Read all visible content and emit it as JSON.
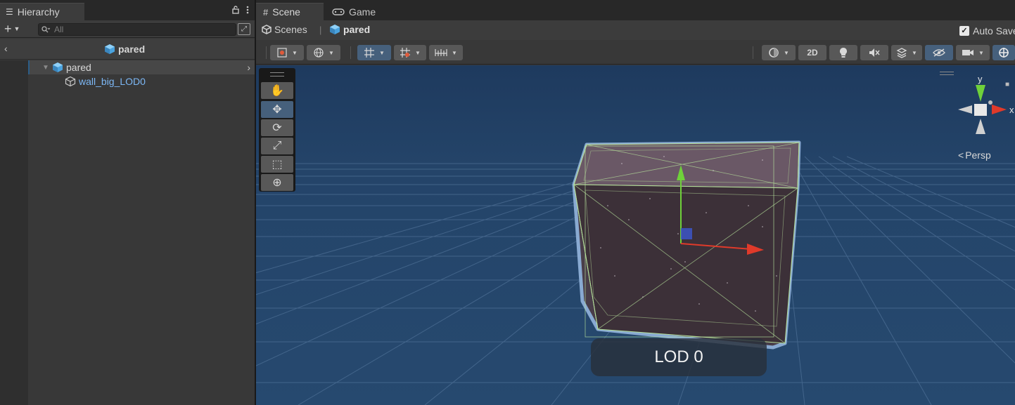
{
  "hierarchy": {
    "tab_label": "Hierarchy",
    "search_placeholder": "All",
    "scene_name": "pared",
    "items": [
      {
        "label": "pared"
      },
      {
        "label": "wall_big_LOD0"
      }
    ]
  },
  "scene_view": {
    "tabs": [
      {
        "label": "Scene"
      },
      {
        "label": "Game"
      }
    ],
    "breadcrumb": {
      "root": "Scenes",
      "current": "pared"
    },
    "auto_save": {
      "label": "Auto Save",
      "checked": true
    },
    "toolbar": {
      "mode_2d": "2D"
    },
    "gizmo": {
      "y_label": "y",
      "x_label": "x",
      "projection": "Persp"
    },
    "lod_label": "LOD 0"
  },
  "colors": {
    "selection_blue": "#46607c",
    "hierarchy_child_text": "#7cb7f5",
    "viewport_sky": "#1f3a5c",
    "gizmo_y": "#6fd13a",
    "gizmo_x": "#e03a2a"
  },
  "icons": {
    "hierarchy_tab": "list-icon",
    "lock": "lock-icon",
    "menu": "kebab-menu-icon",
    "scene_tab": "grid-icon",
    "game_tab": "gamepad-icon",
    "gameobject": "cube-icon"
  }
}
